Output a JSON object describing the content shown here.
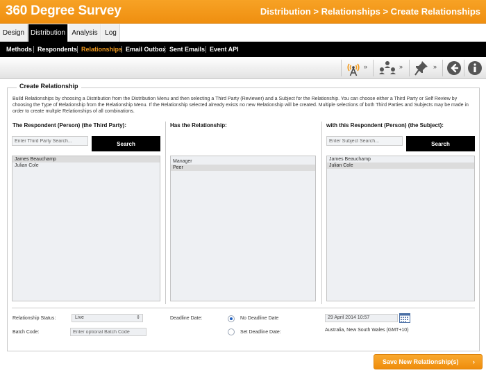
{
  "header": {
    "app_title": "360 Degree Survey",
    "breadcrumb": "Distribution > Relationships > Create Relationships"
  },
  "tabs": [
    {
      "label": "Design"
    },
    {
      "label": "Distribution",
      "active": true
    },
    {
      "label": "Analysis"
    },
    {
      "label": "Log"
    }
  ],
  "subnav": [
    {
      "label": "Methods"
    },
    {
      "label": "Respondents"
    },
    {
      "label": "Relationships",
      "active": true
    },
    {
      "label": "Email Outbox"
    },
    {
      "label": "Sent Emails"
    },
    {
      "label": "Event API"
    }
  ],
  "toolbar": {
    "icons": [
      "broadcast-icon",
      "hierarchy-icon",
      "pin-icon",
      "back-icon",
      "info-icon"
    ],
    "expand_glyph": "»"
  },
  "panel": {
    "legend": "Create Relationship",
    "intro": "Build Relationships by choosing a Distribution from the Distribution Menu and then selecting a Third Party (Reviewer) and a Subject for the Relationship. You can choose either a Third Party or Self Review by choosing the Type of Relationship from the Relationship Menu. If the Relationship selected already exists no new Relationship will be created. Multiple selections of both Third Parties and Subjects may be made in order to create multple Relationships of all combinations."
  },
  "columns": {
    "third_party": {
      "heading": "The Respondent (Person) (the Third Party):",
      "search_placeholder": "Enter Third Party Search...",
      "search_label": "Search",
      "items": [
        {
          "label": "James Beauchamp",
          "selected": true
        },
        {
          "label": "Julian Cole",
          "selected": false
        }
      ]
    },
    "relationship": {
      "heading": "Has the Relationship:",
      "items": [
        {
          "label": "Manager",
          "selected": false
        },
        {
          "label": "Peer",
          "selected": true
        }
      ]
    },
    "subject": {
      "heading": "with this Respondent (Person) (the Subject):",
      "search_placeholder": "Enter Subject Search...",
      "search_label": "Search",
      "items": [
        {
          "label": "James Beauchamp",
          "selected": false
        },
        {
          "label": "Julian Cole",
          "selected": true
        }
      ]
    }
  },
  "form": {
    "status_label": "Relationship Status:",
    "status_value": "Live",
    "status_arrow": "⇕",
    "batch_label": "Batch Code:",
    "batch_placeholder": "Enter optional Batch Code",
    "deadline_label": "Deadline Date:",
    "no_deadline_label": "No Deadline Date",
    "set_deadline_label": "Set Deadline Date:",
    "deadline_selected": "none",
    "date_value": "29 April      2014   10:57",
    "timezone": "Australia, New South Wales (GMT+10)"
  },
  "actions": {
    "save_label": "Save New Relationship(s)",
    "save_arrow": "›"
  },
  "colors": {
    "brand_orange": "#f29a1d",
    "nav_black": "#000000",
    "accent_blue": "#1f5fbf"
  }
}
